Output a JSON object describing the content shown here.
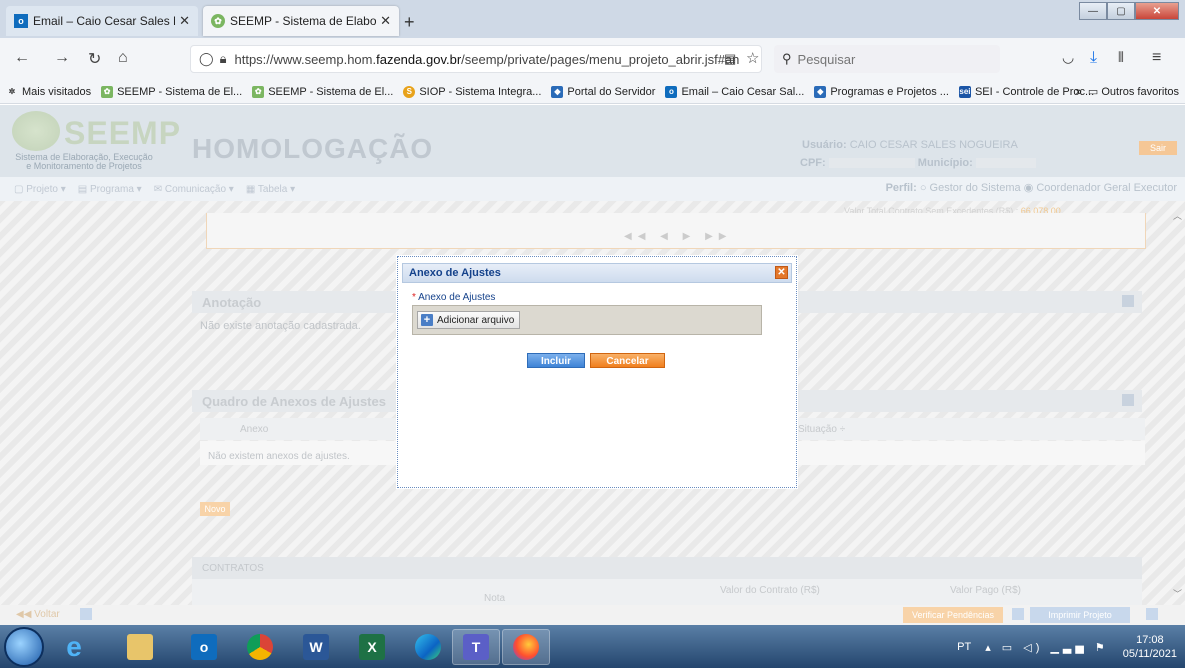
{
  "browser": {
    "tabs": [
      {
        "title": "Email – Caio Cesar Sales Nogue",
        "icon": "outlook-icon",
        "active": false
      },
      {
        "title": "SEEMP - Sistema de Elaboração",
        "icon": "seemp-icon",
        "active": true
      }
    ],
    "new_tab": "+",
    "url_prefix": "https://www.seemp.hom.",
    "url_domain": "fazenda.gov.br",
    "url_suffix": "/seemp/private/pages/menu_projeto_abrir.jsf#an",
    "search_placeholder": "Pesquisar",
    "bookmarks": [
      {
        "label": "Mais visitados",
        "icon": "gear-icon"
      },
      {
        "label": "SEEMP - Sistema de El...",
        "icon": "seemp-icon"
      },
      {
        "label": "SEEMP - Sistema de El...",
        "icon": "seemp-icon"
      },
      {
        "label": "SIOP - Sistema Integra...",
        "icon": "siop-icon"
      },
      {
        "label": "Portal do Servidor",
        "icon": "portal-icon"
      },
      {
        "label": "Email – Caio Cesar Sal...",
        "icon": "outlook-icon"
      },
      {
        "label": "Programas e Projetos ...",
        "icon": "portal-icon"
      },
      {
        "label": "SEI - Controle de Proc...",
        "icon": "sei-icon"
      }
    ],
    "bookmarks_more": "»",
    "other_bookmarks": "Outros favoritos"
  },
  "header": {
    "logo": "SEEMP",
    "logo_sub_1": "Sistema de Elaboração, Execução",
    "logo_sub_2": "e Monitoramento de Projetos",
    "environment": "HOMOLOGAÇÃO",
    "user_label": "Usuário:",
    "user_value": "CAIO CESAR SALES NOGUEIRA",
    "cpf_label": "CPF:",
    "municipio_label": "Município:",
    "sair": "Sair",
    "perfil_label": "Perfil:",
    "perfil_option_1": "Gestor do Sistema",
    "perfil_option_2": "Coordenador Geral Executor"
  },
  "menu": {
    "items": [
      "Projeto",
      "Programa",
      "Comunicação",
      "Tabela"
    ]
  },
  "main": {
    "valor_total_label": "Valor Total Contrato Sem Excedentes (R$)",
    "valor_total": "66.078,00",
    "pager": "◀◀ ◀ ▶ ▶▶",
    "anotacao_title": "Anotação",
    "anotacao_empty": "Não existe anotação cadastrada.",
    "quadro_title": "Quadro de Anexos de Ajustes",
    "col_anexo": "Anexo",
    "col_situacao": "Situação ÷",
    "anexos_empty": "Não existem anexos de ajustes.",
    "novo": "Novo",
    "contratos_title": "CONTRATOS",
    "col_valor_contrato": "Valor do Contrato (R$)",
    "col_valor_pago": "Valor Pago (R$)",
    "col_nota": "Nota"
  },
  "footer": {
    "voltar": "◀◀ Voltar",
    "verificar": "Verificar Pendências",
    "imprimir": "Imprimir Projeto"
  },
  "modal": {
    "title": "Anexo de Ajustes",
    "field_required_mark": "*",
    "field_label": "Anexo de Ajustes",
    "add_file": "Adicionar arquivo",
    "incluir": "Incluir",
    "cancelar": "Cancelar"
  },
  "taskbar": {
    "apps": [
      "ie-icon",
      "explorer-icon",
      "outlook-icon",
      "chrome-icon",
      "word-icon",
      "excel-icon",
      "edge-icon",
      "teams-icon",
      "firefox-icon"
    ],
    "lang": "PT",
    "time": "17:08",
    "date": "05/11/2021"
  }
}
